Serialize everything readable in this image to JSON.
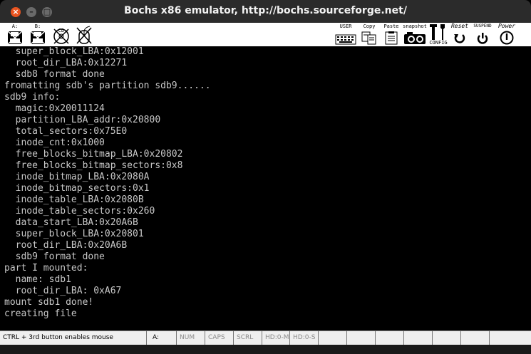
{
  "window": {
    "title": "Bochs x86 emulator, http://bochs.sourceforge.net/",
    "close_glyph": "×",
    "minimize_glyph": "–",
    "maximize_glyph": "□"
  },
  "toolbar": {
    "floppy_a": "A:",
    "floppy_b": "B:",
    "cdrom": "CD",
    "user": "USER",
    "copy": "Copy",
    "paste": "Paste",
    "snapshot": "snapshot",
    "config": "CONFIG",
    "reset": "Reset",
    "suspend": "SUSPEND",
    "power": "Power"
  },
  "terminal": {
    "lines": [
      "  super_block_LBA:0x12001",
      "  root_dir_LBA:0x12271",
      "  sdb8 format done",
      "fromatting sdb's partition sdb9......",
      "sdb9 info:",
      "  magic:0x20011124",
      "  partition_LBA_addr:0x20800",
      "  total_sectors:0x75E0",
      "  inode_cnt:0x1000",
      "  free_blocks_bitmap_LBA:0x20802",
      "  free_blocks_bitmap_sectors:0x8",
      "  inode_bitmap_LBA:0x2080A",
      "  inode_bitmap_sectors:0x1",
      "  inode_table_LBA:0x2080B",
      "  inode_table_sectors:0x260",
      "  data_start_LBA:0x20A6B",
      "  super_block_LBA:0x20801",
      "  root_dir_LBA:0x20A6B",
      "  sdb9 format done",
      "part I mounted:",
      "  name: sdb1",
      "  root_dir_LBA: 0xA67",
      "mount sdb1 done!",
      "creating file"
    ],
    "cursor": "_"
  },
  "statusbar": {
    "mouse_hint": "CTRL + 3rd button enables mouse",
    "drive": "A:",
    "num": "NUM",
    "caps": "CAPS",
    "scrl": "SCRL",
    "hd0m": "HD:0-M",
    "hd0s": "HD:0-S"
  }
}
